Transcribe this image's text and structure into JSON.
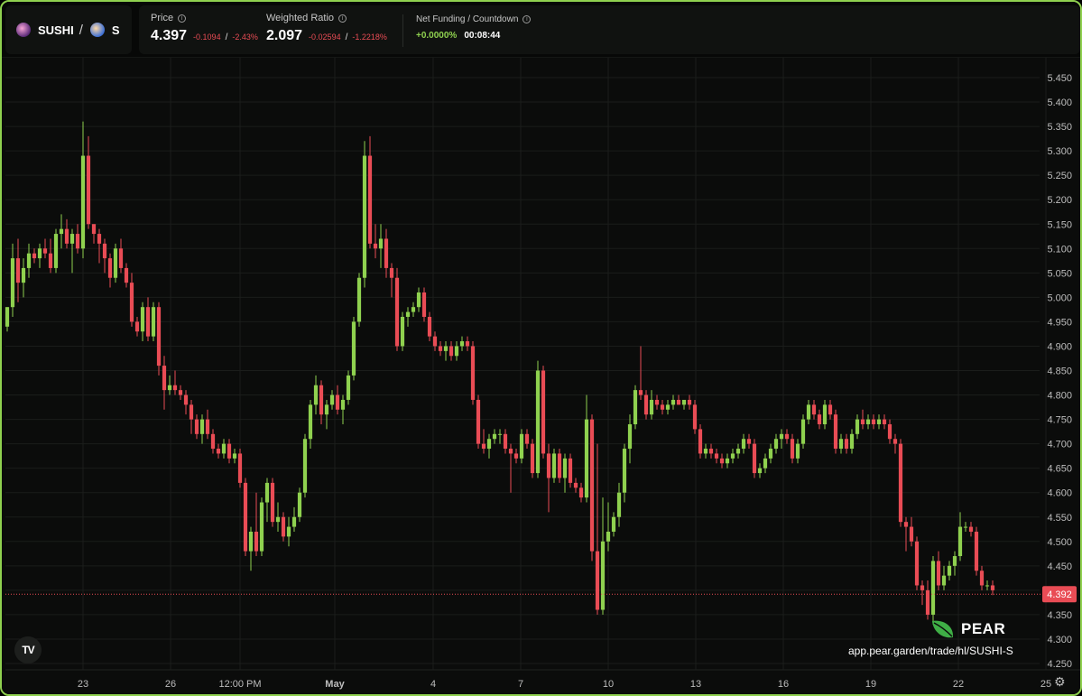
{
  "header": {
    "base_symbol": "SUSHI",
    "separator": "/",
    "quote_symbol": "S",
    "price": {
      "title": "Price",
      "value": "4.397",
      "change": "-0.1094",
      "divider": "/",
      "change_pct": "-2.43%"
    },
    "ratio": {
      "title": "Weighted Ratio",
      "value": "2.097",
      "change": "-0.02594",
      "divider": "/",
      "change_pct": "-1.2218%"
    },
    "funding": {
      "title": "Net Funding / Countdown",
      "rate": "+0.0000%",
      "countdown": "00:08:44"
    }
  },
  "brand": {
    "name": "PEAR",
    "url": "app.pear.garden/trade/hl/SUSHI-S",
    "logo_text": "TV"
  },
  "icons": {
    "settings": "settings-icon",
    "info": "info-icon",
    "tradingview": "tradingview-logo"
  },
  "colors": {
    "up": "#8fd14f",
    "down": "#e94c55",
    "border": "#8fd14f",
    "background": "#0b0c0b",
    "grid": "#1b1d1b",
    "current_price_line": "#e94c55"
  },
  "chart_data": {
    "type": "candlestick",
    "y_axis": {
      "min": 4.25,
      "max": 5.45,
      "ticks": [
        "5.450",
        "5.400",
        "5.350",
        "5.300",
        "5.250",
        "5.200",
        "5.150",
        "5.100",
        "5.050",
        "5.000",
        "4.950",
        "4.900",
        "4.850",
        "4.800",
        "4.750",
        "4.700",
        "4.650",
        "4.600",
        "4.550",
        "4.500",
        "4.450",
        "4.400",
        "4.350",
        "4.300",
        "4.250"
      ]
    },
    "x_axis": {
      "ticks": [
        "23",
        "26",
        "12:00 PM",
        "May",
        "4",
        "7",
        "10",
        "13",
        "16",
        "19",
        "22",
        "25"
      ],
      "bold_ticks": [
        "May"
      ]
    },
    "current_price": 4.392,
    "current_price_label": "4.392",
    "candles": [
      [
        4.94,
        4.98,
        4.93,
        4.98
      ],
      [
        4.98,
        5.11,
        4.96,
        5.08
      ],
      [
        5.08,
        5.12,
        4.99,
        5.03
      ],
      [
        5.03,
        5.08,
        5.0,
        5.06
      ],
      [
        5.06,
        5.11,
        5.04,
        5.09
      ],
      [
        5.09,
        5.1,
        5.07,
        5.08
      ],
      [
        5.08,
        5.11,
        5.06,
        5.1
      ],
      [
        5.1,
        5.12,
        5.08,
        5.09
      ],
      [
        5.09,
        5.12,
        5.05,
        5.06
      ],
      [
        5.06,
        5.14,
        5.05,
        5.13
      ],
      [
        5.13,
        5.17,
        5.1,
        5.14
      ],
      [
        5.14,
        5.16,
        5.1,
        5.11
      ],
      [
        5.11,
        5.14,
        5.05,
        5.13
      ],
      [
        5.13,
        5.15,
        5.09,
        5.1
      ],
      [
        5.1,
        5.36,
        5.08,
        5.29
      ],
      [
        5.29,
        5.33,
        5.14,
        5.15
      ],
      [
        5.15,
        5.15,
        5.11,
        5.13
      ],
      [
        5.13,
        5.14,
        5.07,
        5.11
      ],
      [
        5.11,
        5.12,
        5.05,
        5.08
      ],
      [
        5.08,
        5.09,
        5.02,
        5.04
      ],
      [
        5.04,
        5.11,
        5.03,
        5.1
      ],
      [
        5.1,
        5.12,
        5.05,
        5.06
      ],
      [
        5.06,
        5.07,
        5.02,
        5.03
      ],
      [
        5.03,
        5.05,
        4.94,
        4.95
      ],
      [
        4.95,
        4.96,
        4.92,
        4.93
      ],
      [
        4.93,
        4.99,
        4.91,
        4.98
      ],
      [
        4.98,
        5.0,
        4.91,
        4.92
      ],
      [
        4.92,
        4.99,
        4.91,
        4.98
      ],
      [
        4.98,
        4.99,
        4.84,
        4.86
      ],
      [
        4.86,
        4.88,
        4.77,
        4.81
      ],
      [
        4.81,
        4.84,
        4.8,
        4.82
      ],
      [
        4.82,
        4.85,
        4.8,
        4.81
      ],
      [
        4.81,
        4.82,
        4.79,
        4.8
      ],
      [
        4.8,
        4.81,
        4.76,
        4.78
      ],
      [
        4.78,
        4.79,
        4.72,
        4.75
      ],
      [
        4.75,
        4.76,
        4.71,
        4.72
      ],
      [
        4.72,
        4.76,
        4.7,
        4.75
      ],
      [
        4.75,
        4.77,
        4.71,
        4.72
      ],
      [
        4.72,
        4.73,
        4.68,
        4.69
      ],
      [
        4.69,
        4.7,
        4.67,
        4.68
      ],
      [
        4.68,
        4.71,
        4.67,
        4.7
      ],
      [
        4.7,
        4.71,
        4.66,
        4.67
      ],
      [
        4.67,
        4.69,
        4.66,
        4.68
      ],
      [
        4.68,
        4.69,
        4.61,
        4.62
      ],
      [
        4.62,
        4.63,
        4.47,
        4.48
      ],
      [
        4.48,
        4.53,
        4.44,
        4.52
      ],
      [
        4.52,
        4.6,
        4.47,
        4.48
      ],
      [
        4.48,
        4.59,
        4.47,
        4.58
      ],
      [
        4.58,
        4.63,
        4.54,
        4.62
      ],
      [
        4.62,
        4.63,
        4.53,
        4.54
      ],
      [
        4.54,
        4.58,
        4.52,
        4.55
      ],
      [
        4.55,
        4.56,
        4.5,
        4.51
      ],
      [
        4.51,
        4.55,
        4.49,
        4.53
      ],
      [
        4.53,
        4.57,
        4.52,
        4.55
      ],
      [
        4.55,
        4.61,
        4.54,
        4.6
      ],
      [
        4.6,
        4.72,
        4.59,
        4.71
      ],
      [
        4.71,
        4.79,
        4.69,
        4.78
      ],
      [
        4.78,
        4.84,
        4.76,
        4.82
      ],
      [
        4.82,
        4.83,
        4.74,
        4.76
      ],
      [
        4.76,
        4.79,
        4.73,
        4.78
      ],
      [
        4.78,
        4.81,
        4.77,
        4.8
      ],
      [
        4.8,
        4.82,
        4.76,
        4.77
      ],
      [
        4.77,
        4.8,
        4.74,
        4.79
      ],
      [
        4.79,
        4.85,
        4.78,
        4.84
      ],
      [
        4.84,
        4.96,
        4.83,
        4.95
      ],
      [
        4.95,
        5.05,
        4.94,
        5.04
      ],
      [
        5.04,
        5.32,
        5.02,
        5.29
      ],
      [
        5.29,
        5.33,
        5.1,
        5.11
      ],
      [
        5.11,
        5.15,
        5.08,
        5.1
      ],
      [
        5.1,
        5.15,
        5.06,
        5.12
      ],
      [
        5.12,
        5.14,
        5.04,
        5.06
      ],
      [
        5.06,
        5.07,
        5.0,
        5.04
      ],
      [
        5.04,
        5.06,
        4.89,
        4.9
      ],
      [
        4.9,
        4.97,
        4.89,
        4.96
      ],
      [
        4.96,
        4.98,
        4.94,
        4.97
      ],
      [
        4.97,
        4.99,
        4.96,
        4.98
      ],
      [
        4.98,
        5.02,
        4.97,
        5.01
      ],
      [
        5.01,
        5.02,
        4.95,
        4.96
      ],
      [
        4.96,
        4.97,
        4.91,
        4.92
      ],
      [
        4.92,
        4.93,
        4.89,
        4.9
      ],
      [
        4.9,
        4.91,
        4.88,
        4.89
      ],
      [
        4.89,
        4.91,
        4.87,
        4.9
      ],
      [
        4.9,
        4.91,
        4.87,
        4.88
      ],
      [
        4.88,
        4.91,
        4.87,
        4.9
      ],
      [
        4.9,
        4.92,
        4.89,
        4.91
      ],
      [
        4.91,
        4.92,
        4.89,
        4.9
      ],
      [
        4.9,
        4.91,
        4.78,
        4.79
      ],
      [
        4.79,
        4.8,
        4.69,
        4.7
      ],
      [
        4.7,
        4.73,
        4.68,
        4.69
      ],
      [
        4.69,
        4.72,
        4.67,
        4.71
      ],
      [
        4.71,
        4.73,
        4.7,
        4.72
      ],
      [
        4.72,
        4.73,
        4.7,
        4.72
      ],
      [
        4.72,
        4.73,
        4.68,
        4.69
      ],
      [
        4.69,
        4.7,
        4.6,
        4.68
      ],
      [
        4.68,
        4.69,
        4.66,
        4.67
      ],
      [
        4.67,
        4.73,
        4.66,
        4.72
      ],
      [
        4.72,
        4.73,
        4.69,
        4.7
      ],
      [
        4.7,
        4.71,
        4.63,
        4.64
      ],
      [
        4.64,
        4.87,
        4.63,
        4.85
      ],
      [
        4.85,
        4.86,
        4.67,
        4.68
      ],
      [
        4.68,
        4.7,
        4.56,
        4.63
      ],
      [
        4.63,
        4.69,
        4.62,
        4.68
      ],
      [
        4.68,
        4.69,
        4.62,
        4.63
      ],
      [
        4.63,
        4.68,
        4.6,
        4.67
      ],
      [
        4.67,
        4.68,
        4.61,
        4.62
      ],
      [
        4.62,
        4.63,
        4.6,
        4.61
      ],
      [
        4.61,
        4.62,
        4.58,
        4.59
      ],
      [
        4.59,
        4.8,
        4.58,
        4.75
      ],
      [
        4.75,
        4.76,
        4.46,
        4.48
      ],
      [
        4.48,
        4.7,
        4.35,
        4.36
      ],
      [
        4.36,
        4.59,
        4.35,
        4.5
      ],
      [
        4.5,
        4.58,
        4.48,
        4.52
      ],
      [
        4.52,
        4.56,
        4.51,
        4.55
      ],
      [
        4.55,
        4.62,
        4.53,
        4.6
      ],
      [
        4.6,
        4.7,
        4.58,
        4.69
      ],
      [
        4.69,
        4.76,
        4.66,
        4.74
      ],
      [
        4.74,
        4.82,
        4.73,
        4.81
      ],
      [
        4.81,
        4.9,
        4.79,
        4.8
      ],
      [
        4.8,
        4.81,
        4.75,
        4.76
      ],
      [
        4.76,
        4.81,
        4.75,
        4.79
      ],
      [
        4.79,
        4.8,
        4.77,
        4.78
      ],
      [
        4.78,
        4.79,
        4.76,
        4.77
      ],
      [
        4.77,
        4.79,
        4.76,
        4.78
      ],
      [
        4.78,
        4.8,
        4.77,
        4.79
      ],
      [
        4.79,
        4.8,
        4.78,
        4.78
      ],
      [
        4.78,
        4.79,
        4.77,
        4.79
      ],
      [
        4.79,
        4.8,
        4.77,
        4.78
      ],
      [
        4.78,
        4.79,
        4.72,
        4.73
      ],
      [
        4.73,
        4.74,
        4.67,
        4.68
      ],
      [
        4.68,
        4.7,
        4.67,
        4.69
      ],
      [
        4.69,
        4.7,
        4.67,
        4.68
      ],
      [
        4.68,
        4.69,
        4.66,
        4.67
      ],
      [
        4.67,
        4.68,
        4.65,
        4.66
      ],
      [
        4.66,
        4.68,
        4.65,
        4.67
      ],
      [
        4.67,
        4.69,
        4.66,
        4.68
      ],
      [
        4.68,
        4.7,
        4.67,
        4.69
      ],
      [
        4.69,
        4.72,
        4.68,
        4.71
      ],
      [
        4.71,
        4.72,
        4.69,
        4.7
      ],
      [
        4.7,
        4.71,
        4.63,
        4.64
      ],
      [
        4.64,
        4.66,
        4.63,
        4.65
      ],
      [
        4.65,
        4.68,
        4.64,
        4.67
      ],
      [
        4.67,
        4.7,
        4.66,
        4.69
      ],
      [
        4.69,
        4.72,
        4.68,
        4.71
      ],
      [
        4.71,
        4.73,
        4.69,
        4.72
      ],
      [
        4.72,
        4.73,
        4.7,
        4.71
      ],
      [
        4.71,
        4.72,
        4.66,
        4.67
      ],
      [
        4.67,
        4.71,
        4.66,
        4.7
      ],
      [
        4.7,
        4.76,
        4.69,
        4.75
      ],
      [
        4.75,
        4.79,
        4.74,
        4.78
      ],
      [
        4.78,
        4.79,
        4.75,
        4.76
      ],
      [
        4.76,
        4.77,
        4.73,
        4.74
      ],
      [
        4.74,
        4.79,
        4.73,
        4.78
      ],
      [
        4.78,
        4.79,
        4.75,
        4.76
      ],
      [
        4.76,
        4.77,
        4.68,
        4.69
      ],
      [
        4.69,
        4.72,
        4.68,
        4.71
      ],
      [
        4.71,
        4.72,
        4.68,
        4.69
      ],
      [
        4.69,
        4.73,
        4.68,
        4.72
      ],
      [
        4.72,
        4.76,
        4.71,
        4.75
      ],
      [
        4.75,
        4.77,
        4.73,
        4.74
      ],
      [
        4.74,
        4.76,
        4.73,
        4.75
      ],
      [
        4.75,
        4.76,
        4.73,
        4.74
      ],
      [
        4.74,
        4.76,
        4.73,
        4.75
      ],
      [
        4.75,
        4.76,
        4.73,
        4.74
      ],
      [
        4.74,
        4.75,
        4.7,
        4.71
      ],
      [
        4.71,
        4.72,
        4.68,
        4.7
      ],
      [
        4.7,
        4.71,
        4.53,
        4.54
      ],
      [
        4.54,
        4.55,
        4.48,
        4.53
      ],
      [
        4.53,
        4.55,
        4.49,
        4.5
      ],
      [
        4.5,
        4.51,
        4.4,
        4.41
      ],
      [
        4.41,
        4.42,
        4.37,
        4.4
      ],
      [
        4.4,
        4.42,
        4.34,
        4.35
      ],
      [
        4.35,
        4.47,
        4.33,
        4.46
      ],
      [
        4.46,
        4.48,
        4.4,
        4.41
      ],
      [
        4.41,
        4.45,
        4.4,
        4.43
      ],
      [
        4.43,
        4.46,
        4.42,
        4.45
      ],
      [
        4.45,
        4.48,
        4.43,
        4.47
      ],
      [
        4.47,
        4.56,
        4.46,
        4.53
      ],
      [
        4.53,
        4.54,
        4.52,
        4.53
      ],
      [
        4.53,
        4.54,
        4.51,
        4.52
      ],
      [
        4.52,
        4.53,
        4.43,
        4.44
      ],
      [
        4.44,
        4.45,
        4.4,
        4.41
      ],
      [
        4.41,
        4.42,
        4.4,
        4.41
      ],
      [
        4.41,
        4.42,
        4.39,
        4.4
      ]
    ]
  }
}
